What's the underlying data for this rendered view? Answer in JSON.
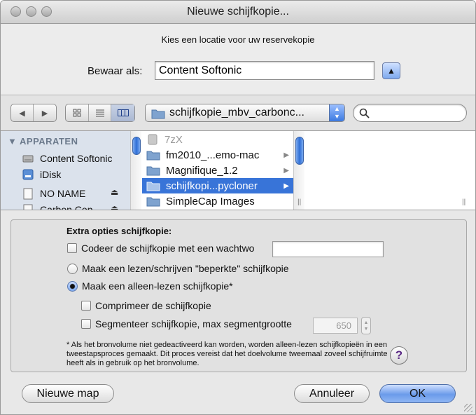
{
  "window": {
    "title": "Nieuwe schijfkopie..."
  },
  "save": {
    "prompt": "Kies een locatie voor uw reservekopie",
    "label": "Bewaar als:",
    "value": "Content Softonic"
  },
  "toolbar": {
    "path": "schijfkopie_mbv_carbonc..."
  },
  "sidebar": {
    "header": "APPARATEN",
    "items": [
      {
        "label": "Content Softonic",
        "icon": "hard-drive-icon"
      },
      {
        "label": "iDisk",
        "icon": "idisk-icon"
      },
      {
        "label": "NO NAME",
        "icon": "disk-icon"
      },
      {
        "label": "Carbon Cop...",
        "icon": "disk-icon"
      }
    ]
  },
  "files": [
    {
      "label": "7zX"
    },
    {
      "label": "fm2010_...emo-mac"
    },
    {
      "label": "Magnifique_1.2"
    },
    {
      "label": "schijfkopi...pycloner"
    },
    {
      "label": "SimpleCap Images"
    }
  ],
  "options": {
    "title": "Extra opties schijfkopie:",
    "encrypt": "Codeer de schijfkopie met een wachtwo",
    "rw_limited": "Maak een lezen/schrijven \"beperkte\" schijfkopie",
    "readonly": "Maak een alleen-lezen schijfkopie*",
    "compress": "Comprimeer de schijfkopie",
    "segment": "Segmenteer schijfkopie, max segmentgrootte",
    "segment_size": "650",
    "footnote": "* Als het bronvolume niet gedeactiveerd kan worden, worden alleen-lezen schijfkopieën in een tweestapsproces gemaakt. Dit proces vereist dat het doelvolume tweemaal zoveel schijfruimte heeft als in gebruik op het bronvolume."
  },
  "buttons": {
    "new_folder": "Nieuwe map",
    "cancel": "Annuleer",
    "ok": "OK"
  }
}
